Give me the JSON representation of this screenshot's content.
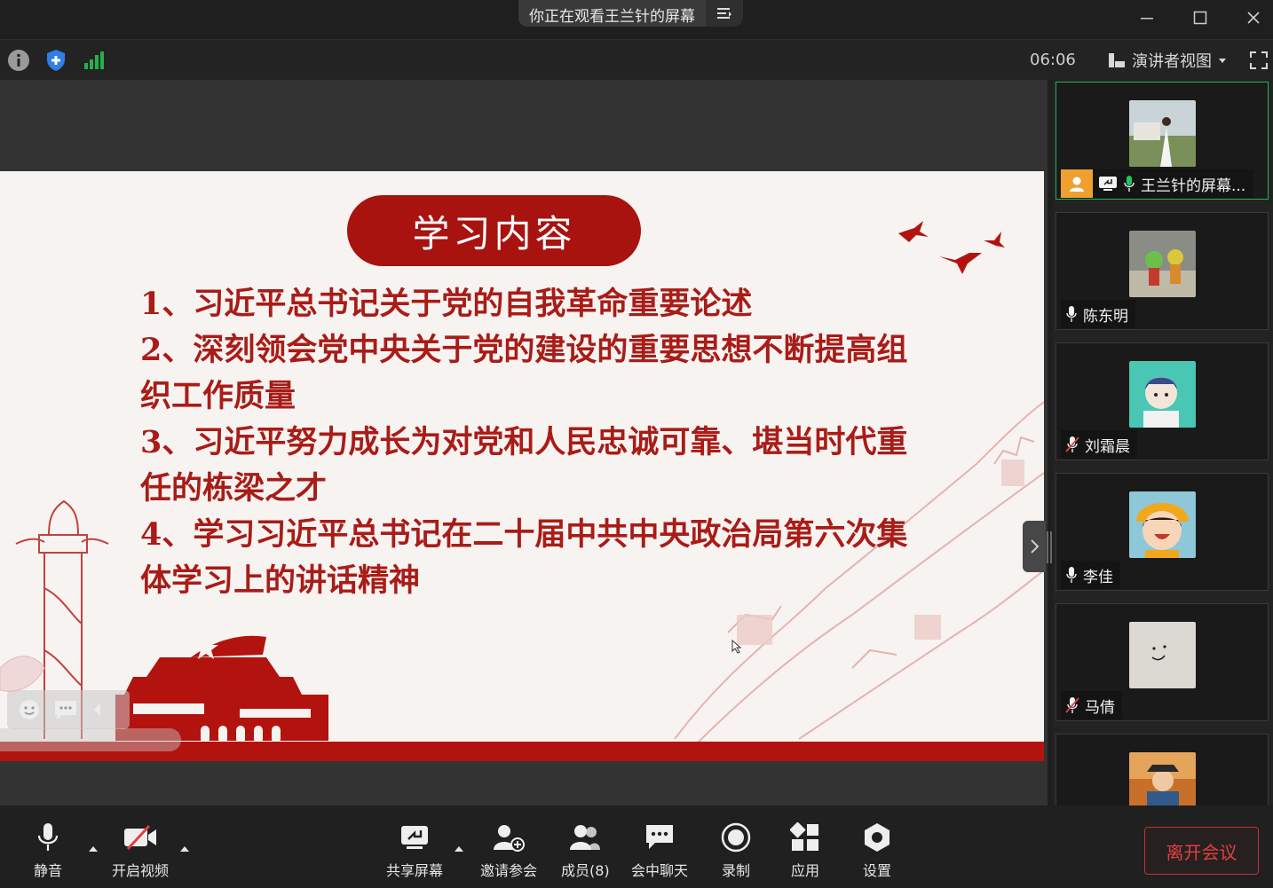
{
  "window": {
    "title": "你正在观看王兰针的屏幕"
  },
  "infobar": {
    "timer": "06:06",
    "view_mode": "演讲者视图"
  },
  "slide": {
    "title": "学习内容",
    "lines": [
      "1、习近平总书记关于党的自我革命重要论述",
      "2、深刻领会党中央关于党的建设的重要思想不断提高组织工作质量",
      "3、习近平努力成长为对党和人民忠诚可靠、堪当时代重任的栋梁之才",
      "4、学习习近平总书记在二十届中共中央政治局第六次集体学习上的讲话精神"
    ]
  },
  "participants": [
    {
      "name": "王兰针的屏幕...",
      "mic": "on",
      "host": true,
      "sharing": true,
      "active": true
    },
    {
      "name": "陈东明",
      "mic": "on"
    },
    {
      "name": "刘霜晨",
      "mic": "muted"
    },
    {
      "name": "李佳",
      "mic": "on"
    },
    {
      "name": "马倩",
      "mic": "muted"
    },
    {
      "name": "",
      "mic": ""
    }
  ],
  "toolbar": {
    "mute": "静音",
    "video": "开启视频",
    "share": "共享屏幕",
    "invite": "邀请参会",
    "members": "成员(8)",
    "chat": "会中聊天",
    "record": "录制",
    "apps": "应用",
    "settings": "设置",
    "leave": "离开会议"
  },
  "colors": {
    "accent_red": "#a8120f",
    "active_border": "#21b35a",
    "leave_red": "#e0413e"
  }
}
